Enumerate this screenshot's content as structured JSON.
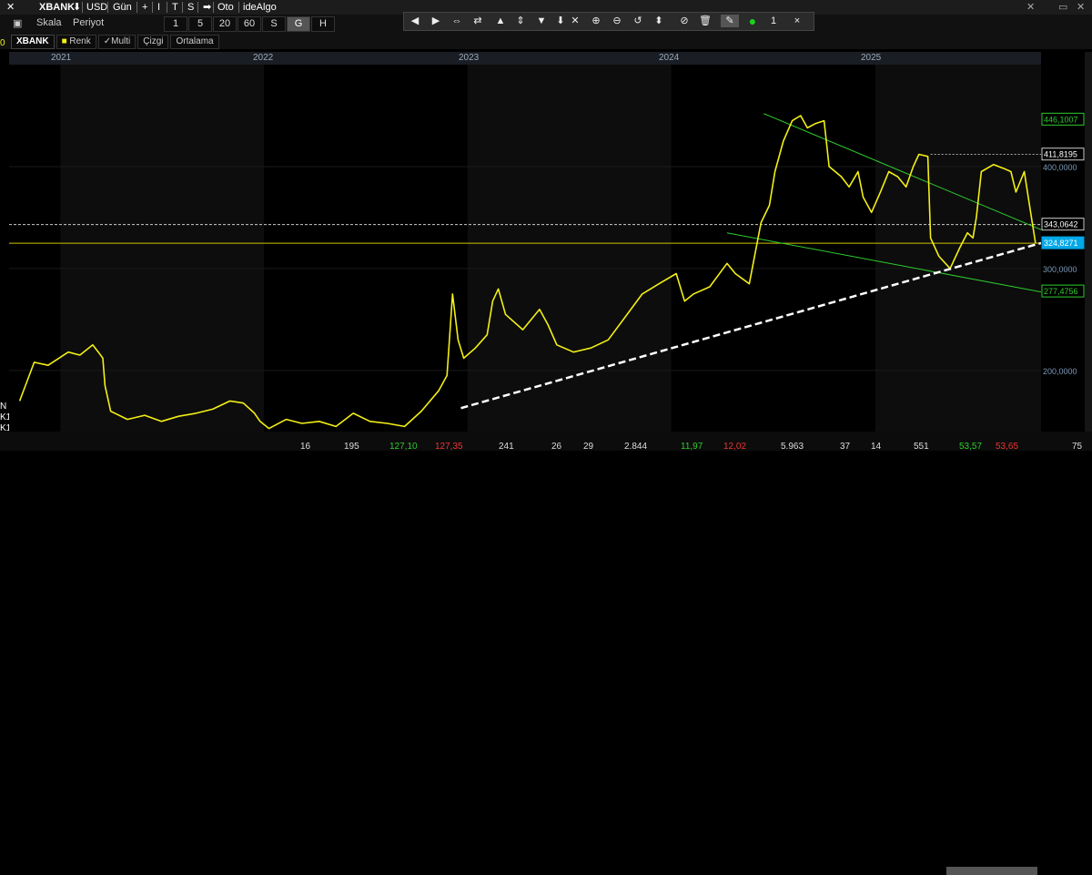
{
  "top_bar": {
    "symbol": "XBANK",
    "currency": "USD",
    "period": "Gün",
    "plus": "+",
    "i": "I",
    "t": "T",
    "s": "S",
    "oto": "Oto",
    "idealgo": "ideAlgo"
  },
  "row2": {
    "scale_label": "Skala",
    "period_label": "Periyot"
  },
  "periods": [
    "1",
    "5",
    "20",
    "60",
    "S",
    "G",
    "H"
  ],
  "active_period": "G",
  "toolbar": {
    "count": "1",
    "close": "×"
  },
  "tabs": {
    "symbol": "XBANK",
    "color": "Renk",
    "multi": "✓Multi",
    "line": "Çizgi",
    "average": "Ortalama"
  },
  "years": [
    "2021",
    "2022",
    "2023",
    "2024",
    "2025"
  ],
  "left_edge_labels": [
    "0",
    "N",
    "K1",
    "K1"
  ],
  "colors": {
    "price": "#f3ef14",
    "channel": "#2ecc2e",
    "trend": "#ffffff",
    "current": "#00a8e8",
    "hline": "#d0c000",
    "background": "#000000"
  },
  "chart_data": {
    "type": "line",
    "x_range": [
      "2020-10",
      "2025-10"
    ],
    "ylim": [
      140,
      500
    ],
    "y_ticks": [
      "200,0000",
      "300,0000",
      "400,0000"
    ],
    "price_labels": {
      "upper_channel": "446,1007",
      "resistance": "411,8195",
      "dotted": "343,0642",
      "current": "324,8271",
      "lower_channel": "277,4756"
    },
    "series": [
      {
        "values": [
          [
            "2020-10-20",
            170
          ],
          [
            "2020-11-15",
            208
          ],
          [
            "2020-12-10",
            205
          ],
          [
            "2021-01-15",
            218
          ],
          [
            "2021-02-05",
            215
          ],
          [
            "2021-02-28",
            225
          ],
          [
            "2021-03-10",
            218
          ],
          [
            "2021-03-18",
            212
          ],
          [
            "2021-03-22",
            185
          ],
          [
            "2021-04-01",
            160
          ],
          [
            "2021-05-01",
            152
          ],
          [
            "2021-06-01",
            156
          ],
          [
            "2021-07-01",
            150
          ],
          [
            "2021-08-01",
            155
          ],
          [
            "2021-09-01",
            158
          ],
          [
            "2021-10-01",
            162
          ],
          [
            "2021-11-01",
            170
          ],
          [
            "2021-11-25",
            168
          ],
          [
            "2021-12-15",
            158
          ],
          [
            "2021-12-25",
            150
          ],
          [
            "2022-01-10",
            143
          ],
          [
            "2022-02-10",
            152
          ],
          [
            "2022-03-10",
            148
          ],
          [
            "2022-04-10",
            150
          ],
          [
            "2022-05-10",
            145
          ],
          [
            "2022-06-10",
            158
          ],
          [
            "2022-07-10",
            150
          ],
          [
            "2022-08-10",
            148
          ],
          [
            "2022-09-10",
            145
          ],
          [
            "2022-10-10",
            160
          ],
          [
            "2022-11-10",
            180
          ],
          [
            "2022-11-25",
            195
          ],
          [
            "2022-12-05",
            275
          ],
          [
            "2022-12-15",
            230
          ],
          [
            "2022-12-25",
            212
          ],
          [
            "2023-01-15",
            222
          ],
          [
            "2023-02-05",
            235
          ],
          [
            "2023-02-15",
            268
          ],
          [
            "2023-02-25",
            280
          ],
          [
            "2023-03-10",
            255
          ],
          [
            "2023-04-10",
            240
          ],
          [
            "2023-05-10",
            260
          ],
          [
            "2023-05-25",
            245
          ],
          [
            "2023-06-10",
            225
          ],
          [
            "2023-07-10",
            218
          ],
          [
            "2023-08-10",
            222
          ],
          [
            "2023-09-10",
            230
          ],
          [
            "2023-10-10",
            252
          ],
          [
            "2023-11-10",
            275
          ],
          [
            "2023-12-10",
            285
          ],
          [
            "2024-01-10",
            295
          ],
          [
            "2024-01-25",
            268
          ],
          [
            "2024-02-10",
            275
          ],
          [
            "2024-03-10",
            282
          ],
          [
            "2024-04-10",
            305
          ],
          [
            "2024-04-25",
            295
          ],
          [
            "2024-05-20",
            285
          ],
          [
            "2024-06-10",
            345
          ],
          [
            "2024-06-25",
            362
          ],
          [
            "2024-07-05",
            395
          ],
          [
            "2024-07-20",
            425
          ],
          [
            "2024-08-05",
            445
          ],
          [
            "2024-08-20",
            450
          ],
          [
            "2024-09-01",
            438
          ],
          [
            "2024-09-15",
            442
          ],
          [
            "2024-10-01",
            445
          ],
          [
            "2024-10-10",
            400
          ],
          [
            "2024-11-01",
            390
          ],
          [
            "2024-11-15",
            380
          ],
          [
            "2024-12-01",
            395
          ],
          [
            "2024-12-10",
            370
          ],
          [
            "2024-12-25",
            355
          ],
          [
            "2025-01-10",
            375
          ],
          [
            "2025-01-25",
            395
          ],
          [
            "2025-02-10",
            390
          ],
          [
            "2025-02-25",
            380
          ],
          [
            "2025-03-10",
            400
          ],
          [
            "2025-03-20",
            412
          ],
          [
            "2025-04-05",
            410
          ],
          [
            "2025-04-10",
            330
          ],
          [
            "2025-04-25",
            312
          ],
          [
            "2025-05-15",
            300
          ],
          [
            "2025-06-01",
            320
          ],
          [
            "2025-06-15",
            335
          ],
          [
            "2025-06-25",
            330
          ],
          [
            "2025-07-01",
            350
          ],
          [
            "2025-07-10",
            395
          ],
          [
            "2025-08-01",
            402
          ],
          [
            "2025-08-20",
            398
          ],
          [
            "2025-09-01",
            395
          ],
          [
            "2025-09-10",
            375
          ],
          [
            "2025-09-25",
            395
          ],
          [
            "2025-10-05",
            360
          ],
          [
            "2025-10-15",
            325
          ]
        ]
      }
    ],
    "trend_line": [
      [
        "2022-12-20",
        163
      ],
      [
        "2025-10-25",
        325
      ]
    ],
    "channel_upper": [
      [
        "2024-06-15",
        452
      ],
      [
        "2025-10-25",
        338
      ]
    ],
    "channel_lower": [
      [
        "2024-04-10",
        335
      ],
      [
        "2025-10-25",
        277
      ]
    ],
    "resistance_line": [
      [
        "2025-04-10",
        412
      ],
      [
        "2025-10-25",
        412
      ]
    ]
  },
  "bottom_values": [
    {
      "text": "16",
      "color": "white"
    },
    {
      "text": "195",
      "color": "white"
    },
    {
      "text": "127,10",
      "color": "green"
    },
    {
      "text": "127,35",
      "color": "red"
    },
    {
      "text": "241",
      "color": "white"
    },
    {
      "text": "26",
      "color": "white"
    },
    {
      "text": "29",
      "color": "white"
    },
    {
      "text": "2.844",
      "color": "white"
    },
    {
      "text": "11,97",
      "color": "green"
    },
    {
      "text": "12,02",
      "color": "red"
    },
    {
      "text": "5.963",
      "color": "white"
    },
    {
      "text": "37",
      "color": "white"
    },
    {
      "text": "14",
      "color": "white"
    },
    {
      "text": "551",
      "color": "white"
    },
    {
      "text": "53,57",
      "color": "green"
    },
    {
      "text": "53,65",
      "color": "red"
    },
    {
      "text": "75",
      "color": "white"
    }
  ]
}
